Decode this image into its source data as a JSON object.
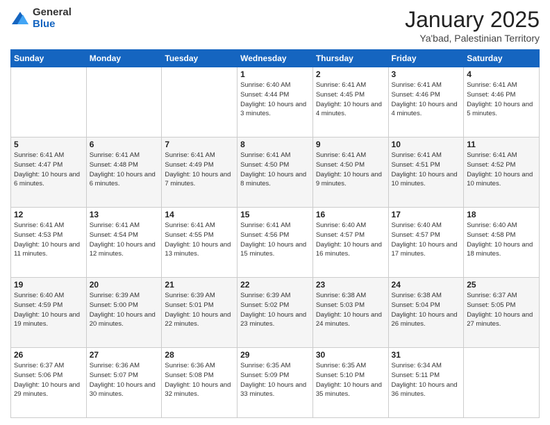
{
  "header": {
    "logo_general": "General",
    "logo_blue": "Blue",
    "month_title": "January 2025",
    "location": "Ya'bad, Palestinian Territory"
  },
  "days_of_week": [
    "Sunday",
    "Monday",
    "Tuesday",
    "Wednesday",
    "Thursday",
    "Friday",
    "Saturday"
  ],
  "weeks": [
    [
      {
        "day": "",
        "info": ""
      },
      {
        "day": "",
        "info": ""
      },
      {
        "day": "",
        "info": ""
      },
      {
        "day": "1",
        "info": "Sunrise: 6:40 AM\nSunset: 4:44 PM\nDaylight: 10 hours and 3 minutes."
      },
      {
        "day": "2",
        "info": "Sunrise: 6:41 AM\nSunset: 4:45 PM\nDaylight: 10 hours and 4 minutes."
      },
      {
        "day": "3",
        "info": "Sunrise: 6:41 AM\nSunset: 4:46 PM\nDaylight: 10 hours and 4 minutes."
      },
      {
        "day": "4",
        "info": "Sunrise: 6:41 AM\nSunset: 4:46 PM\nDaylight: 10 hours and 5 minutes."
      }
    ],
    [
      {
        "day": "5",
        "info": "Sunrise: 6:41 AM\nSunset: 4:47 PM\nDaylight: 10 hours and 6 minutes."
      },
      {
        "day": "6",
        "info": "Sunrise: 6:41 AM\nSunset: 4:48 PM\nDaylight: 10 hours and 6 minutes."
      },
      {
        "day": "7",
        "info": "Sunrise: 6:41 AM\nSunset: 4:49 PM\nDaylight: 10 hours and 7 minutes."
      },
      {
        "day": "8",
        "info": "Sunrise: 6:41 AM\nSunset: 4:50 PM\nDaylight: 10 hours and 8 minutes."
      },
      {
        "day": "9",
        "info": "Sunrise: 6:41 AM\nSunset: 4:50 PM\nDaylight: 10 hours and 9 minutes."
      },
      {
        "day": "10",
        "info": "Sunrise: 6:41 AM\nSunset: 4:51 PM\nDaylight: 10 hours and 10 minutes."
      },
      {
        "day": "11",
        "info": "Sunrise: 6:41 AM\nSunset: 4:52 PM\nDaylight: 10 hours and 10 minutes."
      }
    ],
    [
      {
        "day": "12",
        "info": "Sunrise: 6:41 AM\nSunset: 4:53 PM\nDaylight: 10 hours and 11 minutes."
      },
      {
        "day": "13",
        "info": "Sunrise: 6:41 AM\nSunset: 4:54 PM\nDaylight: 10 hours and 12 minutes."
      },
      {
        "day": "14",
        "info": "Sunrise: 6:41 AM\nSunset: 4:55 PM\nDaylight: 10 hours and 13 minutes."
      },
      {
        "day": "15",
        "info": "Sunrise: 6:41 AM\nSunset: 4:56 PM\nDaylight: 10 hours and 15 minutes."
      },
      {
        "day": "16",
        "info": "Sunrise: 6:40 AM\nSunset: 4:57 PM\nDaylight: 10 hours and 16 minutes."
      },
      {
        "day": "17",
        "info": "Sunrise: 6:40 AM\nSunset: 4:57 PM\nDaylight: 10 hours and 17 minutes."
      },
      {
        "day": "18",
        "info": "Sunrise: 6:40 AM\nSunset: 4:58 PM\nDaylight: 10 hours and 18 minutes."
      }
    ],
    [
      {
        "day": "19",
        "info": "Sunrise: 6:40 AM\nSunset: 4:59 PM\nDaylight: 10 hours and 19 minutes."
      },
      {
        "day": "20",
        "info": "Sunrise: 6:39 AM\nSunset: 5:00 PM\nDaylight: 10 hours and 20 minutes."
      },
      {
        "day": "21",
        "info": "Sunrise: 6:39 AM\nSunset: 5:01 PM\nDaylight: 10 hours and 22 minutes."
      },
      {
        "day": "22",
        "info": "Sunrise: 6:39 AM\nSunset: 5:02 PM\nDaylight: 10 hours and 23 minutes."
      },
      {
        "day": "23",
        "info": "Sunrise: 6:38 AM\nSunset: 5:03 PM\nDaylight: 10 hours and 24 minutes."
      },
      {
        "day": "24",
        "info": "Sunrise: 6:38 AM\nSunset: 5:04 PM\nDaylight: 10 hours and 26 minutes."
      },
      {
        "day": "25",
        "info": "Sunrise: 6:37 AM\nSunset: 5:05 PM\nDaylight: 10 hours and 27 minutes."
      }
    ],
    [
      {
        "day": "26",
        "info": "Sunrise: 6:37 AM\nSunset: 5:06 PM\nDaylight: 10 hours and 29 minutes."
      },
      {
        "day": "27",
        "info": "Sunrise: 6:36 AM\nSunset: 5:07 PM\nDaylight: 10 hours and 30 minutes."
      },
      {
        "day": "28",
        "info": "Sunrise: 6:36 AM\nSunset: 5:08 PM\nDaylight: 10 hours and 32 minutes."
      },
      {
        "day": "29",
        "info": "Sunrise: 6:35 AM\nSunset: 5:09 PM\nDaylight: 10 hours and 33 minutes."
      },
      {
        "day": "30",
        "info": "Sunrise: 6:35 AM\nSunset: 5:10 PM\nDaylight: 10 hours and 35 minutes."
      },
      {
        "day": "31",
        "info": "Sunrise: 6:34 AM\nSunset: 5:11 PM\nDaylight: 10 hours and 36 minutes."
      },
      {
        "day": "",
        "info": ""
      }
    ]
  ]
}
